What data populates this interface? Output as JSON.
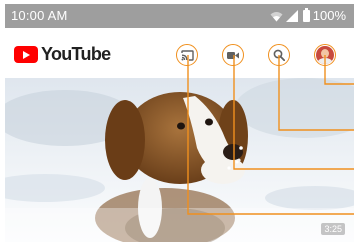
{
  "status_bar": {
    "time": "10:00 AM",
    "battery": "100%",
    "icons": [
      "wifi-icon",
      "signal-icon",
      "battery-icon"
    ]
  },
  "app_bar": {
    "logo_text": "YouTube",
    "actions": [
      "cast-icon",
      "camera-icon",
      "search-icon",
      "account-avatar"
    ]
  },
  "video": {
    "duration": "3:25",
    "thumbnail": "beagle-in-snow"
  },
  "colors": {
    "status_bar_bg": "#9e9e9e",
    "brand_red": "#ff0000",
    "callout_orange": "#f0901e"
  }
}
